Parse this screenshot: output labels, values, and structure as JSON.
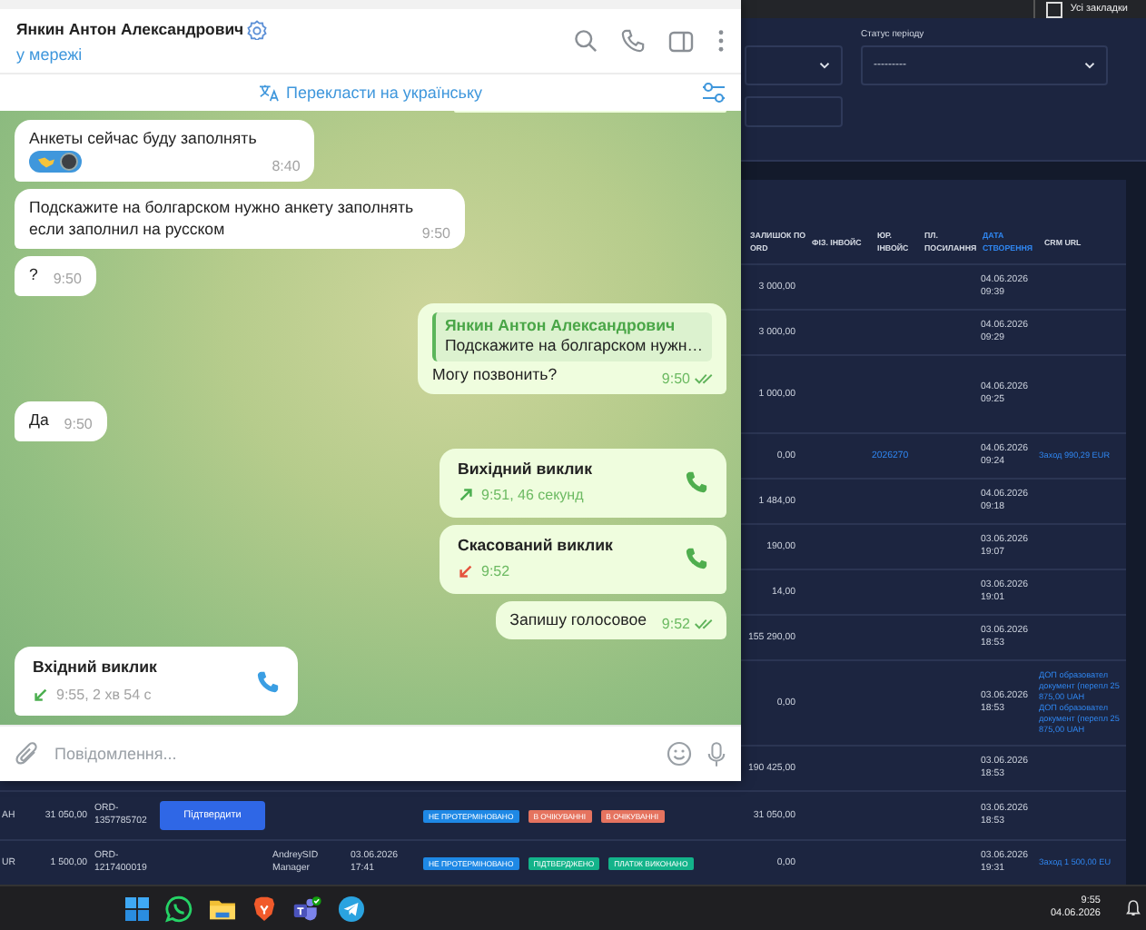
{
  "web_app": {
    "bookmarks": {
      "label": "Усі закладки",
      "checked": false
    },
    "filter": {
      "label": "Статус періоду",
      "value": "---------"
    },
    "table": {
      "columns": [
        {
          "label": "ЗАЛИШОК ПО ORD",
          "sorted": false
        },
        {
          "label": "ФІЗ. ІНВОЙС",
          "sorted": false
        },
        {
          "label": "ЮР. ІНВОЙС",
          "sorted": false
        },
        {
          "label": "ПЛ. ПОСИЛАННЯ",
          "sorted": false
        },
        {
          "label": "ДАТА СТВОРЕННЯ",
          "sorted": true
        },
        {
          "label": "CRM URL",
          "sorted": false
        }
      ],
      "rows": [
        {
          "balance": "3 000,00",
          "created": "04.06.2026 09:39"
        },
        {
          "balance": "3 000,00",
          "created": "04.06.2026 09:29"
        },
        {
          "balance": "1 000,00",
          "created": "04.06.2026 09:25",
          "tall": true
        },
        {
          "balance": "0,00",
          "legal_invoice": "2026270",
          "created": "04.06.2026 09:24",
          "crm_links": [
            "Заход 990,29 EUR"
          ]
        },
        {
          "balance": "1 484,00",
          "created": "04.06.2026 09:18"
        },
        {
          "balance": "190,00",
          "created": "03.06.2026 19:07"
        },
        {
          "balance": "14,00",
          "created": "03.06.2026 19:01"
        },
        {
          "balance": "155 290,00",
          "created": "03.06.2026 18:53"
        },
        {
          "balance": "0,00",
          "created": "03.06.2026 18:53",
          "crm_links": [
            "ДОП образовател документ (перепл 25 875,00 UAH",
            "ДОП образовател документ (перепл 25 875,00 UAH"
          ]
        },
        {
          "balance": "190 425,00",
          "created": "03.06.2026 18:53"
        },
        {
          "currency": "AH",
          "amount": "31 050,00",
          "order": "ORD-1357785702",
          "action": "Підтвердити",
          "badges": [
            {
              "text": "НЕ ПРОТЕРМІНОВАНО",
              "color": "#1e88e5"
            },
            {
              "text": "В ОЧІКУВАННІ",
              "color": "#e5735f"
            },
            {
              "text": "В ОЧІКУВАННІ",
              "color": "#e5735f"
            }
          ],
          "balance": "31 050,00",
          "created": "03.06.2026 18:53"
        },
        {
          "currency": "UR",
          "amount": "1 500,00",
          "order": "ORD-1217400019",
          "manager": "AndreySID Manager",
          "manager_date": "03.06.2026 17:41",
          "badges": [
            {
              "text": "НЕ ПРОТЕРМІНОВАНО",
              "color": "#1e88e5"
            },
            {
              "text": "ПІДТВЕРДЖЕНО",
              "color": "#13b38a"
            },
            {
              "text": "ПЛАТІЖ ВИКОНАНО",
              "color": "#13b38a"
            }
          ],
          "balance": "0,00",
          "created": "03.06.2026 19:31",
          "crm_links": [
            "Заход 1 500,00 EU"
          ]
        }
      ]
    }
  },
  "chat": {
    "contact_name": "Янкин Антон Александрович",
    "status": "у мережі",
    "translate_label": "Перекласти на українську",
    "messages": [
      {
        "kind": "partial",
        "outgoing": true
      },
      {
        "kind": "text",
        "outgoing": false,
        "text": "Анкеты сейчас буду заполнять",
        "time": "8:40",
        "reaction": true
      },
      {
        "kind": "text",
        "outgoing": false,
        "text": "Подскажите на болгарском нужно анкету заполнять если заполнил на русском",
        "time": "9:50"
      },
      {
        "kind": "text",
        "outgoing": false,
        "text": "?",
        "time": "9:50"
      },
      {
        "kind": "reply",
        "outgoing": true,
        "quote_author": "Янкин Антон Александрович",
        "quote_text": "Подскажите на болгарском нужн…",
        "text": "Могу позвонить?",
        "time": "9:50",
        "read": true
      },
      {
        "kind": "text",
        "outgoing": false,
        "text": "Да",
        "time": "9:50"
      },
      {
        "kind": "call",
        "outgoing": true,
        "title": "Вихідний виклик",
        "missed": false,
        "detail": "9:51, 46 секунд"
      },
      {
        "kind": "call",
        "outgoing": true,
        "title": "Скасований виклик",
        "missed": true,
        "detail": "9:52"
      },
      {
        "kind": "text",
        "outgoing": true,
        "text": "Запишу голосовое",
        "time": "9:52",
        "read": true
      },
      {
        "kind": "call",
        "outgoing": false,
        "title": "Вхідний виклик",
        "missed": false,
        "detail": "9:55, 2 хв 54 с"
      }
    ],
    "composer": {
      "placeholder": "Повідомлення..."
    }
  },
  "taskbar": {
    "time": "9:55",
    "date": "04.06.2026"
  }
}
